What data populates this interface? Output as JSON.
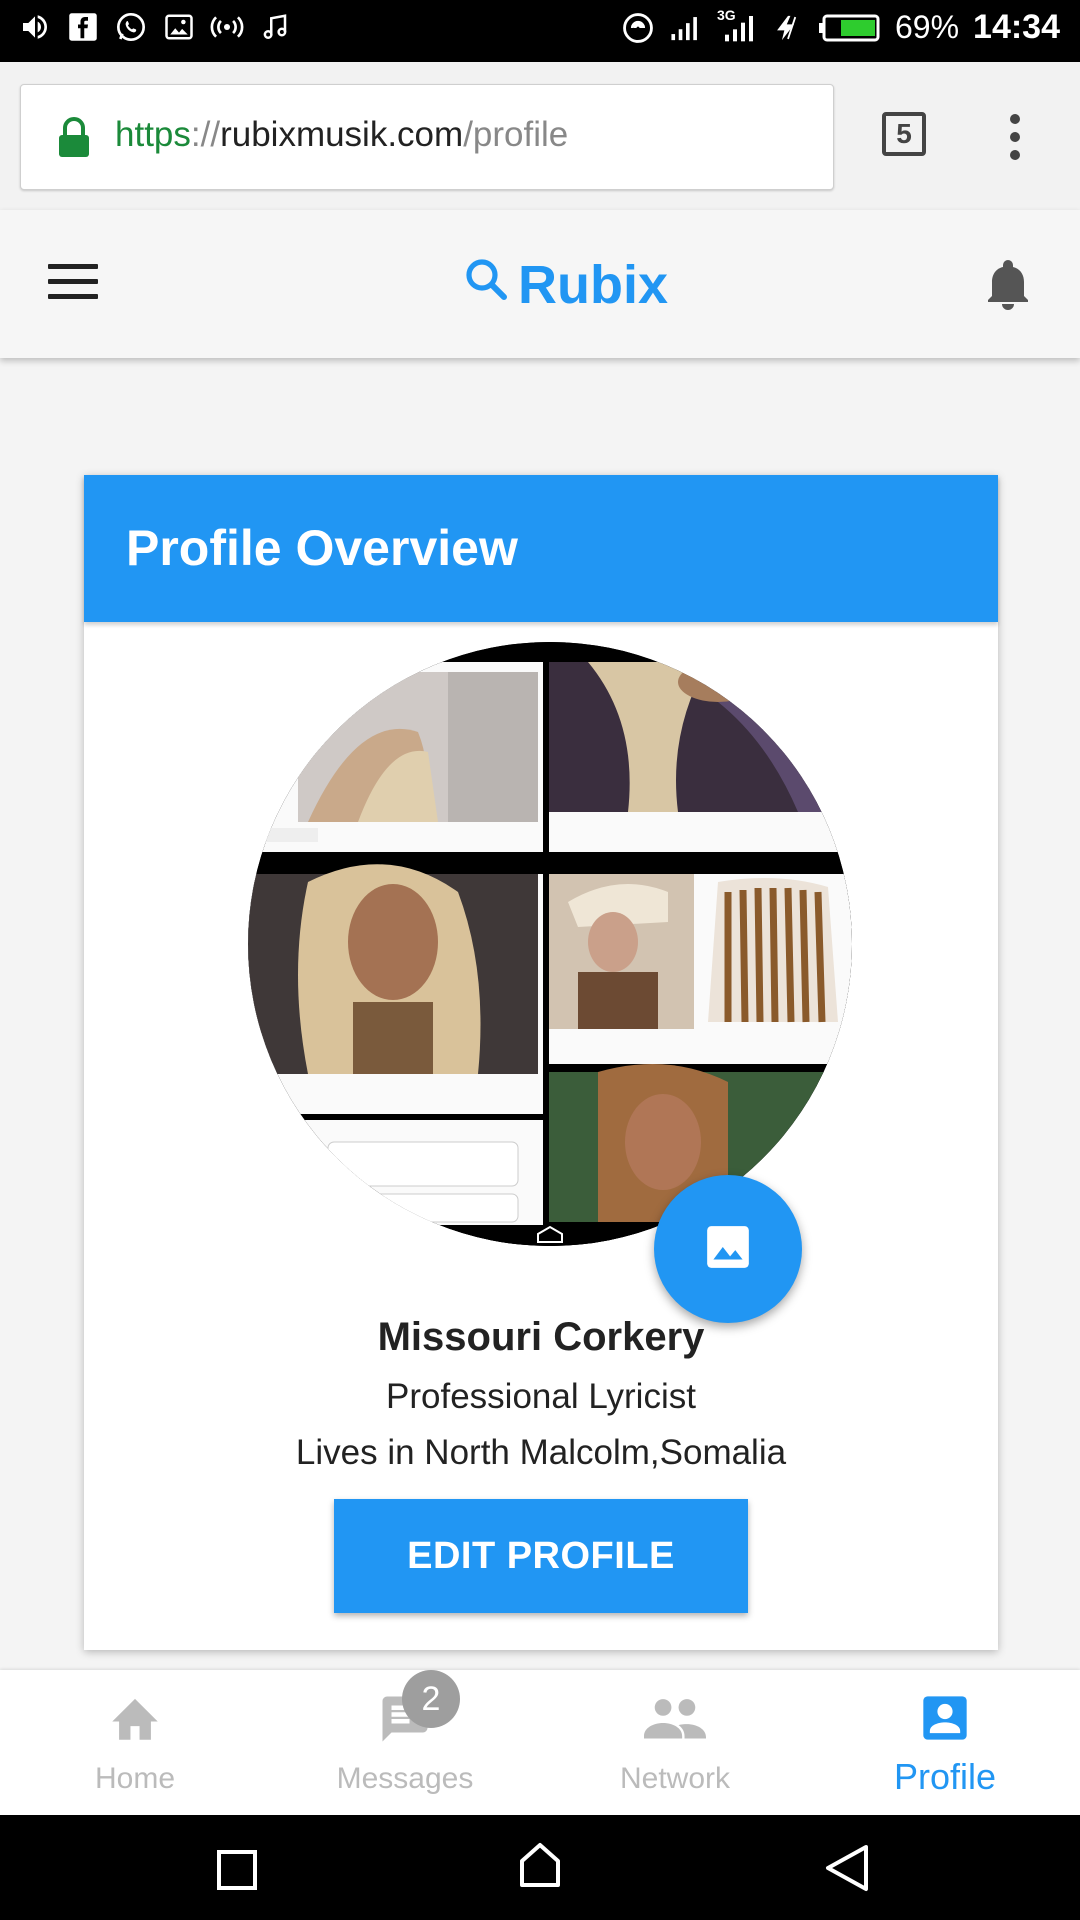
{
  "status_bar": {
    "battery_percent": "69%",
    "time": "14:34",
    "network_label": "3G"
  },
  "browser": {
    "url_scheme": "https",
    "url_sep": "://",
    "url_domain": "rubixmusik.com",
    "url_path": "/profile",
    "tab_count": "5"
  },
  "app_bar": {
    "brand": "Rubix"
  },
  "profile_card": {
    "title": "Profile Overview",
    "name": "Missouri Corkery",
    "role": "Professional Lyricist",
    "location": "Lives in North Malcolm,Somalia",
    "edit_label": "EDIT PROFILE"
  },
  "bottom_nav": {
    "items": [
      {
        "label": "Home"
      },
      {
        "label": "Messages",
        "badge": "2"
      },
      {
        "label": "Network"
      },
      {
        "label": "Profile"
      }
    ]
  },
  "colors": {
    "accent": "#2196f3",
    "secure_green": "#1b8a3a"
  }
}
